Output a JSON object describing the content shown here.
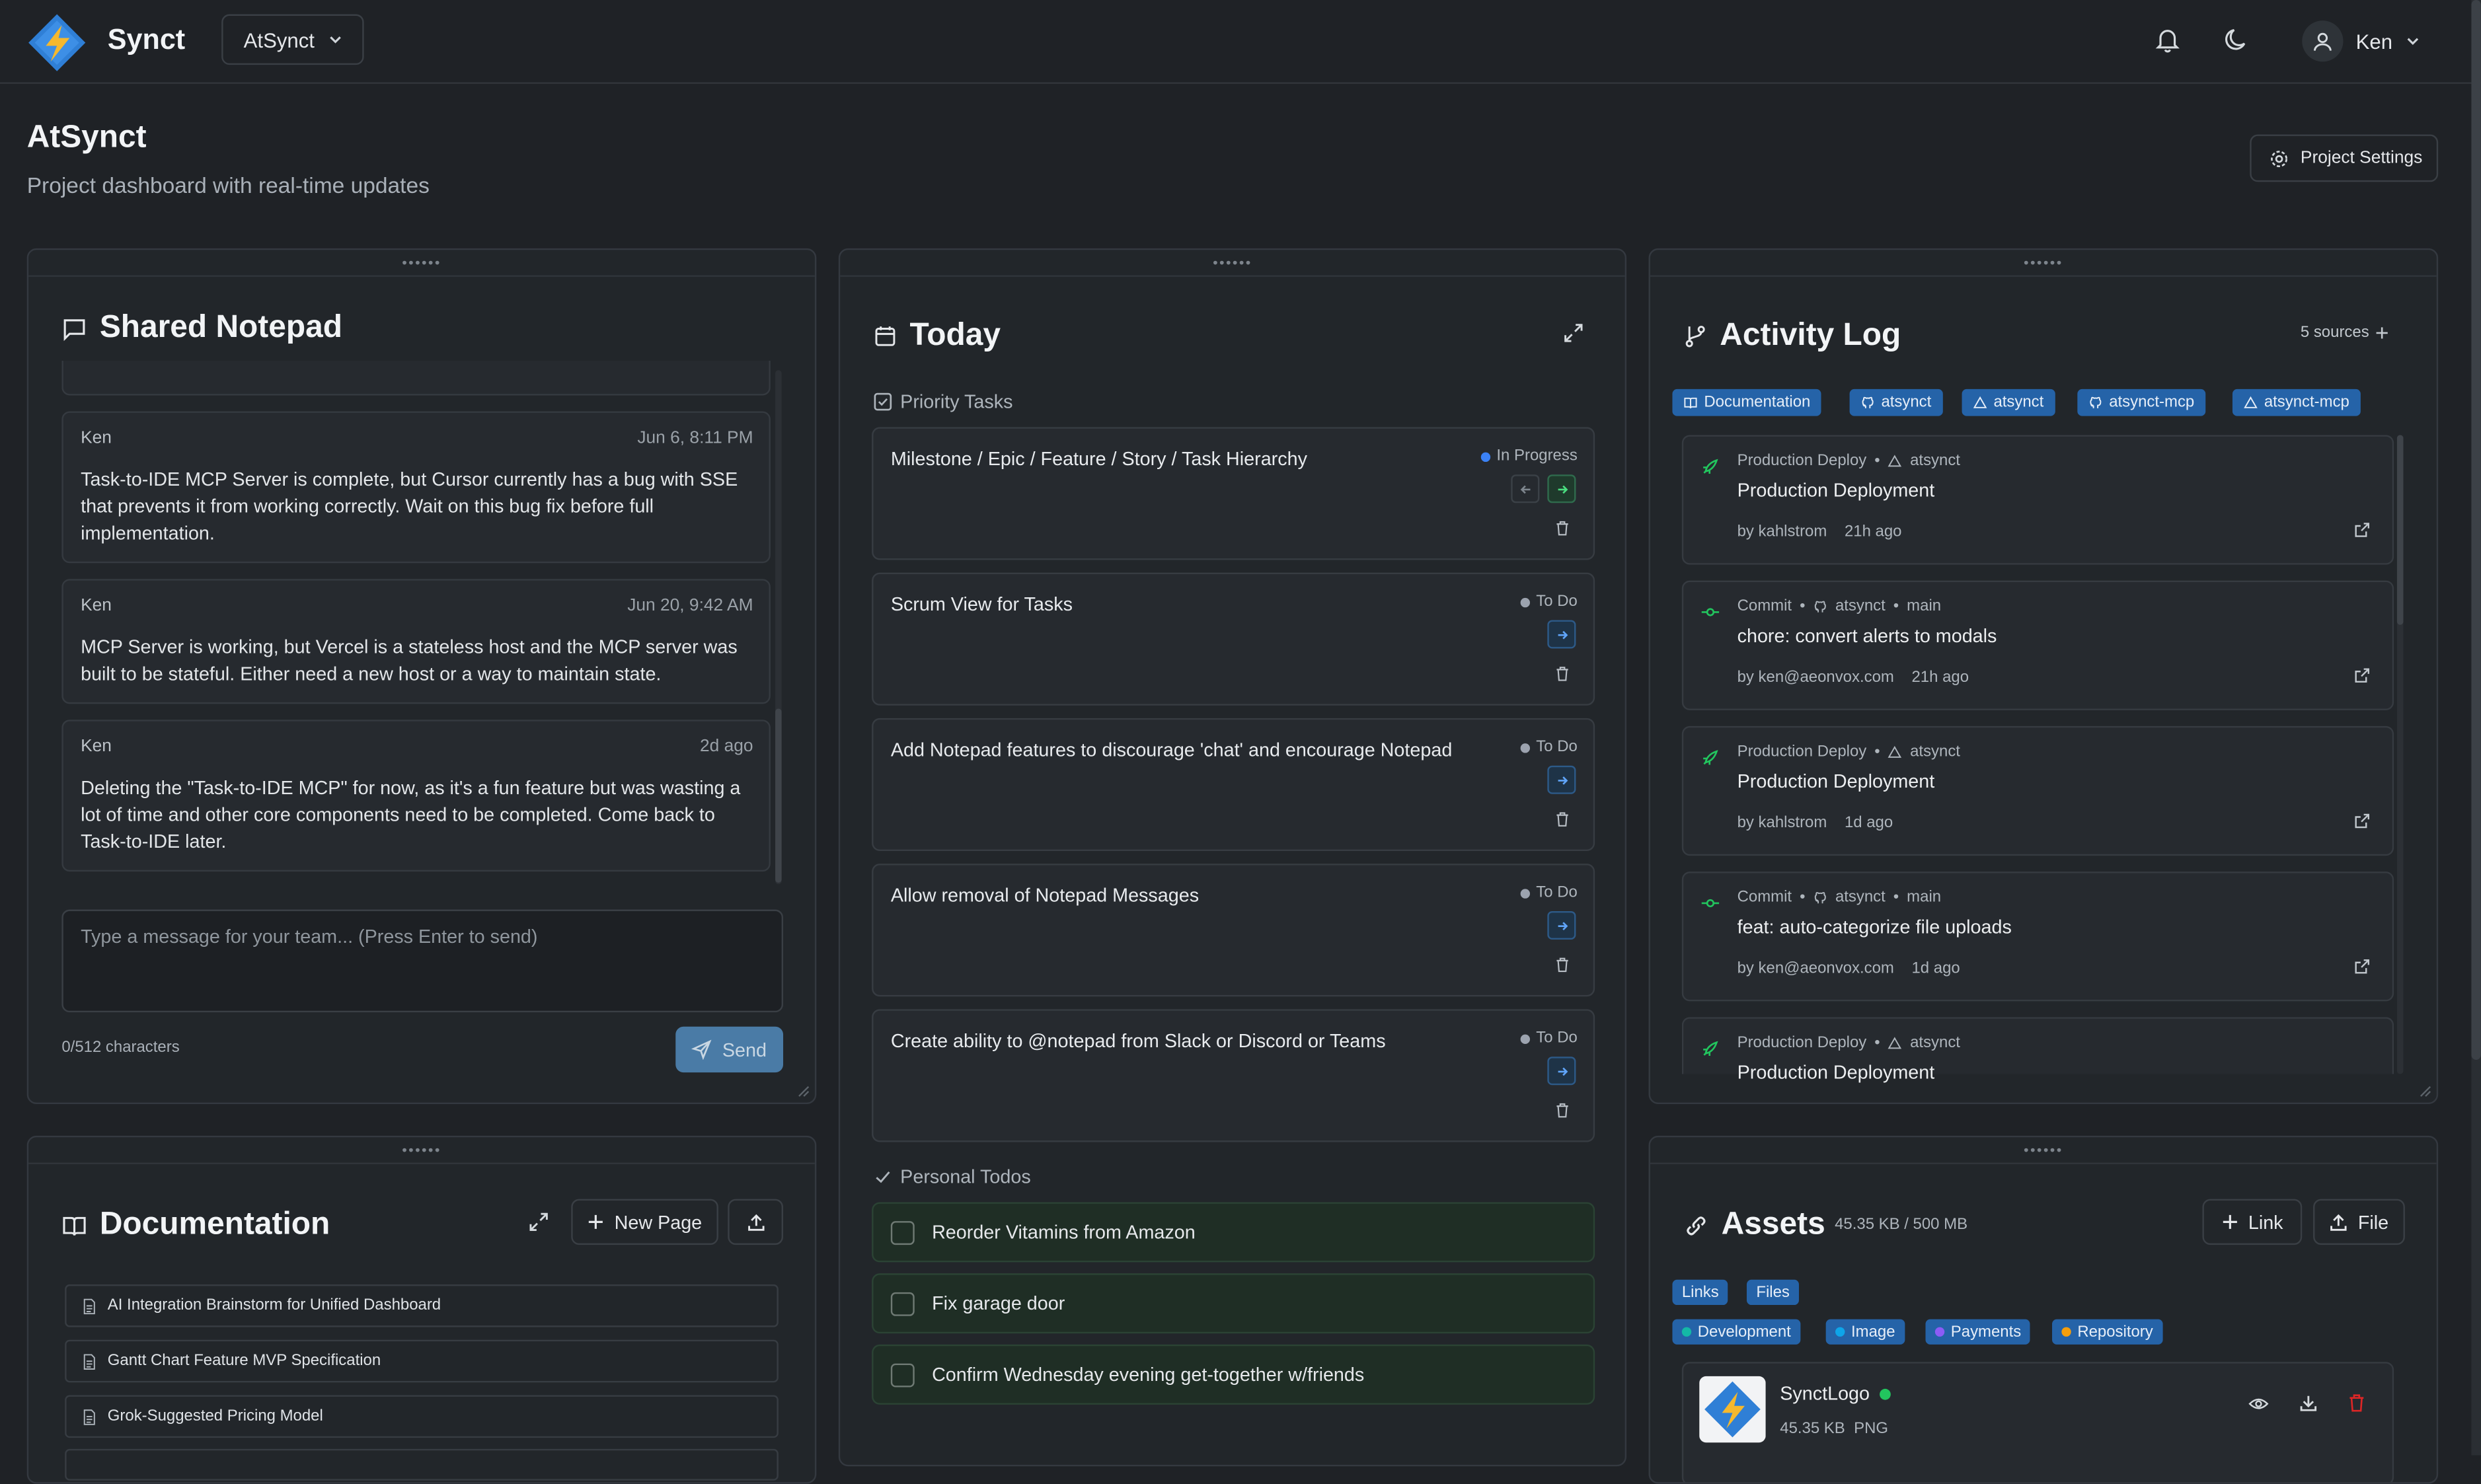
{
  "app": {
    "name": "Synct",
    "project_select": "AtSynct",
    "user": "Ken"
  },
  "page": {
    "title": "AtSynct",
    "subtitle": "Project dashboard with real-time updates",
    "settings_label": "Project Settings"
  },
  "notepad": {
    "title": "Shared Notepad",
    "messages": [
      {
        "author": "Ken",
        "time": "Jun 6, 8:11 PM",
        "text": "Task-to-IDE MCP Server is complete, but Cursor currently has a bug with SSE that prevents it from working correctly. Wait on this bug fix before full implementation."
      },
      {
        "author": "Ken",
        "time": "Jun 20, 9:42 AM",
        "text": "MCP Server is working, but Vercel is a stateless host and the MCP server was built to be stateful. Either need a new host or a way to maintain state."
      },
      {
        "author": "Ken",
        "time": "2d ago",
        "text": "Deleting the \"Task-to-IDE MCP\" for now, as it's a fun feature but was wasting a lot of time and other core components need to be completed. Come back to Task-to-IDE later."
      }
    ],
    "input_placeholder": "Type a message for your team... (Press Enter to send)",
    "char_count": "0/512 characters",
    "send_label": "Send"
  },
  "today": {
    "title": "Today",
    "priority_label": "Priority Tasks",
    "tasks": [
      {
        "title": "Milestone / Epic / Feature / Story / Task Hierarchy",
        "status": "In Progress"
      },
      {
        "title": "Scrum View for Tasks",
        "status": "To Do"
      },
      {
        "title": "Add Notepad features to discourage 'chat' and encourage Notepad",
        "status": "To Do"
      },
      {
        "title": "Allow removal of Notepad Messages",
        "status": "To Do"
      },
      {
        "title": "Create ability to @notepad from Slack or Discord or Teams",
        "status": "To Do"
      }
    ],
    "personal_label": "Personal Todos",
    "todos": [
      "Reorder Vitamins from Amazon",
      "Fix garage door",
      "Confirm Wednesday evening get-together w/friends"
    ]
  },
  "activity": {
    "title": "Activity Log",
    "sources_label": "5 sources",
    "sources": [
      "Documentation",
      "atsynct",
      "atsynct",
      "atsynct-mcp",
      "atsynct-mcp"
    ],
    "entries": [
      {
        "type": "Production Deploy",
        "repo": "atsynct",
        "branch": "",
        "title": "Production Deployment",
        "by": "by kahlstrom",
        "time": "21h ago"
      },
      {
        "type": "Commit",
        "repo": "atsynct",
        "branch": "main",
        "title": "chore: convert alerts to modals",
        "by": "by ken@aeonvox.com",
        "time": "21h ago"
      },
      {
        "type": "Production Deploy",
        "repo": "atsynct",
        "branch": "",
        "title": "Production Deployment",
        "by": "by kahlstrom",
        "time": "1d ago"
      },
      {
        "type": "Commit",
        "repo": "atsynct",
        "branch": "main",
        "title": "feat: auto-categorize file uploads",
        "by": "by ken@aeonvox.com",
        "time": "1d ago"
      },
      {
        "type": "Production Deploy",
        "repo": "atsynct",
        "branch": "",
        "title": "Production Deployment",
        "by": "",
        "time": ""
      }
    ]
  },
  "docs": {
    "title": "Documentation",
    "new_page_label": "New Page",
    "items": [
      "AI Integration Brainstorm for Unified Dashboard",
      "Gantt Chart Feature MVP Specification",
      "Grok-Suggested Pricing Model"
    ]
  },
  "assets": {
    "title": "Assets",
    "usage": "45.35 KB / 500 MB",
    "link_label": "Link",
    "file_label": "File",
    "type_filters": [
      "Links",
      "Files"
    ],
    "categories": [
      {
        "name": "Development",
        "color": "#14b8a6"
      },
      {
        "name": "Image",
        "color": "#0ea5e9"
      },
      {
        "name": "Payments",
        "color": "#8b5cf6"
      },
      {
        "name": "Repository",
        "color": "#f59e0b"
      }
    ],
    "file": {
      "name": "SynctLogo",
      "size": "45.35 KB",
      "type": "PNG"
    }
  },
  "colors": {
    "accent": "#2563a8",
    "in_progress": "#3b82f6",
    "todo": "#9ca3af",
    "online": "#22c55e",
    "deploy": "#22c55e",
    "danger": "#dc2626"
  }
}
